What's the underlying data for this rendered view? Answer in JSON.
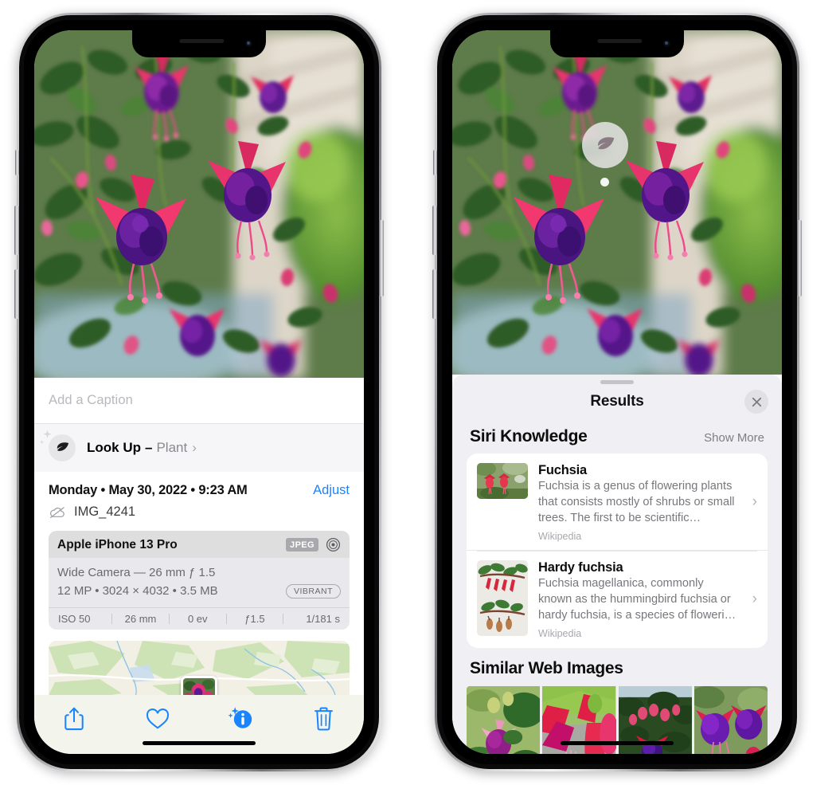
{
  "left_phone": {
    "caption_field": {
      "placeholder": "Add a Caption",
      "value": ""
    },
    "look_up": {
      "label": "Look Up",
      "dash": "–",
      "kind": "Plant",
      "chevron": "›",
      "icon": "leaf-icon"
    },
    "metadata": {
      "date_line": "Monday • May 30, 2022 • 9:23 AM",
      "adjust_label": "Adjust",
      "file_name": "IMG_4241",
      "cloud_icon": "icloud-slash-icon"
    },
    "exif": {
      "device": "Apple iPhone 13 Pro",
      "format_tag": "JPEG",
      "lens_icon": "aperture-icon",
      "lens_line": "Wide Camera — 26 mm ƒ 1.5",
      "size_line": "12 MP • 3024 × 4032 • 3.5 MB",
      "style_tag": "VIBRANT",
      "stats": [
        "ISO 50",
        "26 mm",
        "0 ev",
        "ƒ1.5",
        "1/181 s"
      ]
    },
    "toolbar": [
      {
        "name": "share-button",
        "icon": "share-icon"
      },
      {
        "name": "favorite-button",
        "icon": "heart-icon"
      },
      {
        "name": "info-button",
        "icon": "info-sparkle-icon"
      },
      {
        "name": "delete-button",
        "icon": "trash-icon"
      }
    ]
  },
  "right_phone": {
    "badge": {
      "icon": "leaf-icon"
    },
    "sheet": {
      "title": "Results",
      "close_icon": "close-icon",
      "sections": [
        {
          "title": "Siri Knowledge",
          "action": "Show More",
          "items": [
            {
              "name": "Fuchsia",
              "description": "Fuchsia is a genus of flowering plants that consists mostly of shrubs or small trees. The first to be scientific…",
              "source": "Wikipedia",
              "thumb": "fuchsia-thumb",
              "chevron": "›"
            },
            {
              "name": "Hardy fuchsia",
              "description": "Fuchsia magellanica, commonly known as the hummingbird fuchsia or hardy fuchsia, is a species of floweri…",
              "source": "Wikipedia",
              "thumb": "hardy-fuchsia-thumb",
              "chevron": "›"
            }
          ]
        },
        {
          "title": "Similar Web Images",
          "action": "",
          "thumbs": [
            "web-image-1",
            "web-image-2",
            "web-image-3",
            "web-image-4"
          ]
        }
      ]
    }
  },
  "colors": {
    "accent_blue": "#1a84ff",
    "sheet_bg": "#f0f0f4",
    "card_bg": "#ffffff",
    "secondary_text": "#77777d",
    "exif_card": "#e9e9ed"
  }
}
